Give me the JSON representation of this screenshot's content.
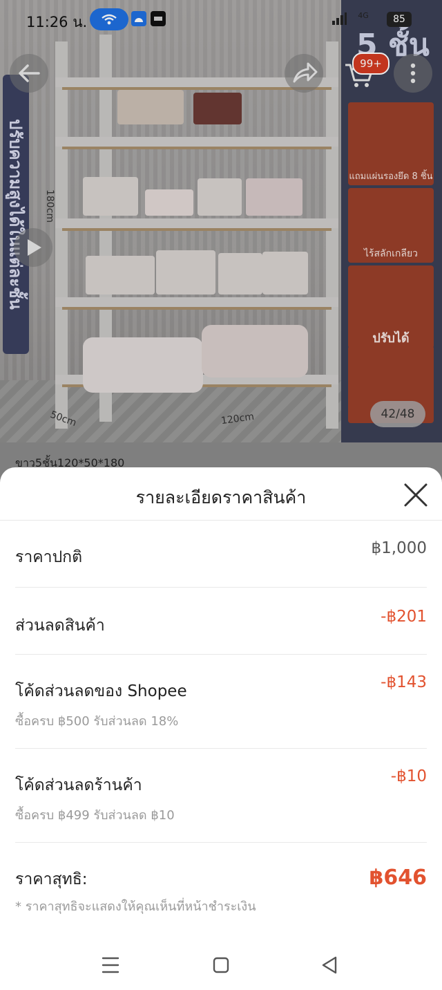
{
  "status_bar": {
    "time": "11:26 น.",
    "battery": "85",
    "network": "4G"
  },
  "product": {
    "image_counter": "42/48",
    "cart_badge": "99+",
    "variant_label": "ขาว5ชั้น120*50*180",
    "vertical_label": "ปรับความสูงได้ในแต่ละชั้น",
    "promo_big": "5 ชั้น",
    "promo_lines": [
      "แถมแผ่นรองยึด 8 ชิ้น",
      "ไร้สลักเกลียว",
      "ปรับได้"
    ],
    "dimensions": {
      "height": "180cm",
      "depth": "50cm",
      "width": "120cm"
    }
  },
  "sheet": {
    "title": "รายละเอียดราคาสินค้า",
    "rows": [
      {
        "label": "ราคาปกติ",
        "value": "฿1,000",
        "sub": ""
      },
      {
        "label": "ส่วนลดสินค้า",
        "value": "-฿201",
        "sub": ""
      },
      {
        "label": "โค้ดส่วนลดของ Shopee",
        "value": "-฿143",
        "sub": "ซื้อครบ ฿500 รับส่วนลด 18%"
      },
      {
        "label": "โค้ดส่วนลดร้านค้า",
        "value": "-฿10",
        "sub": "ซื้อครบ ฿499 รับส่วนลด ฿10"
      }
    ],
    "final": {
      "label": "ราคาสุทธิ:",
      "value": "฿646",
      "note": "* ราคาสุทธิจะแสดงให้คุณเห็นที่หน้าชำระเงิน"
    }
  },
  "colors": {
    "discount": "#e2522f",
    "badge": "#d33a21",
    "status_pill": "#1f6fe0"
  },
  "icons": [
    "back-arrow-icon",
    "share-icon",
    "cart-icon",
    "more-icon",
    "play-icon",
    "close-icon",
    "menu-icon",
    "home-icon",
    "back-triangle-icon"
  ]
}
